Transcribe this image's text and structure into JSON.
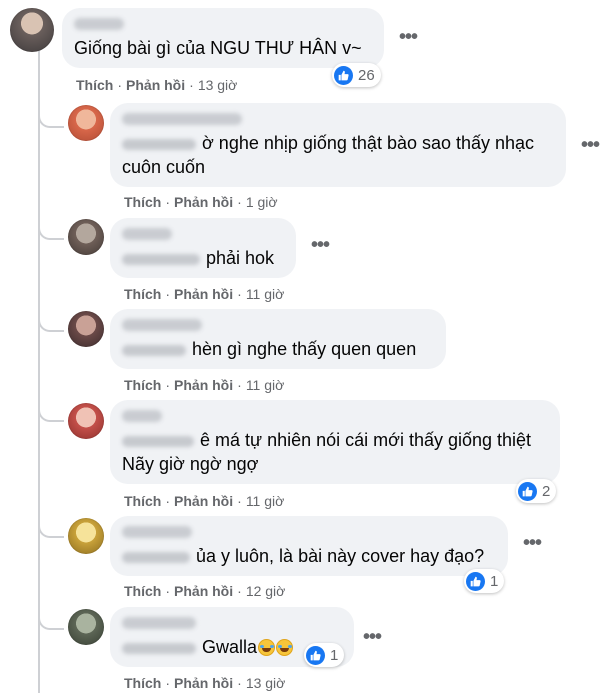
{
  "top_comment": {
    "text": "Giống bài gì của NGU THƯ HÂN v~",
    "like_label": "Thích",
    "reply_label": "Phản hồi",
    "time": "13 giờ",
    "reaction_count": "26"
  },
  "replies": [
    {
      "lines": [
        "ờ nghe nhịp giống thật bào sao thấy nhạc",
        "cuôn cuốn"
      ],
      "like_label": "Thích",
      "reply_label": "Phản hồi",
      "time": "1 giờ",
      "reaction_count": ""
    },
    {
      "lines": [
        "phải hok"
      ],
      "like_label": "Thích",
      "reply_label": "Phản hồi",
      "time": "11 giờ",
      "reaction_count": ""
    },
    {
      "lines": [
        "hèn gì nghe thấy quen quen"
      ],
      "like_label": "Thích",
      "reply_label": "Phản hồi",
      "time": "11 giờ",
      "reaction_count": ""
    },
    {
      "lines": [
        "ê má tự nhiên nói cái mới thấy giống thiệt",
        "Nãy giờ ngờ ngợ"
      ],
      "like_label": "Thích",
      "reply_label": "Phản hồi",
      "time": "11 giờ",
      "reaction_count": "2"
    },
    {
      "lines": [
        "ủa y luôn, là bài này cover hay đạo?"
      ],
      "like_label": "Thích",
      "reply_label": "Phản hồi",
      "time": "12 giờ",
      "reaction_count": "1"
    },
    {
      "lines": [
        "Gwalla"
      ],
      "like_label": "Thích",
      "reply_label": "Phản hồi",
      "time": "13 giờ",
      "reaction_count": "1"
    }
  ],
  "icons": {
    "more": "more-options-icon",
    "like": "like-thumb-icon",
    "emoji": "rofl-emoji-icon"
  },
  "colors": {
    "bubble": "#f0f2f5",
    "like_blue": "#1877f2",
    "meta_gray": "#65676b",
    "thread_line": "#ced0d4"
  }
}
